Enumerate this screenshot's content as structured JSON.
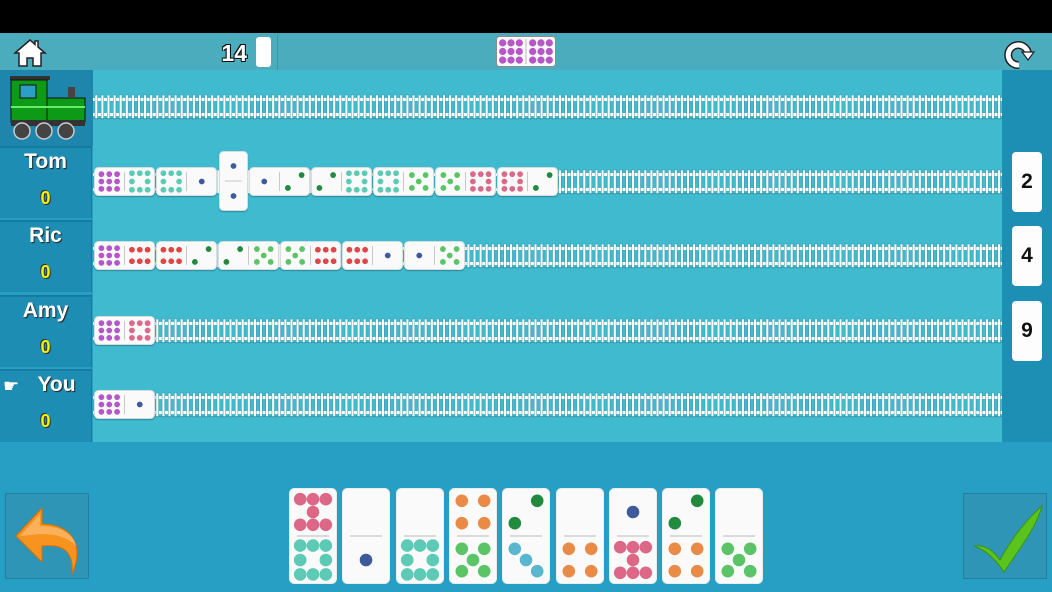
{
  "header": {
    "boneyard_count": "14",
    "engine_domino": [
      9,
      9
    ],
    "home_icon": "home-icon",
    "restart_icon": "restart-icon"
  },
  "pip_colors": {
    "1": "#3f5a99",
    "2": "#218a3e",
    "3": "#59b6cf",
    "4": "#e98a47",
    "5": "#5ac466",
    "6": "#e04646",
    "7": "#dd6787",
    "8": "#da6a8a",
    "9": "#b656ca",
    "10": "#5ccab5"
  },
  "players": [
    {
      "name": "Tom",
      "score": "0",
      "hand_count": "2",
      "is_you": false,
      "train": [
        [
          9,
          10
        ],
        [
          10,
          1
        ],
        [
          1,
          1
        ],
        [
          1,
          2
        ],
        [
          2,
          10
        ],
        [
          10,
          5
        ],
        [
          5,
          8
        ],
        [
          8,
          2
        ]
      ]
    },
    {
      "name": "Ric",
      "score": "0",
      "hand_count": "4",
      "is_you": false,
      "train": [
        [
          9,
          6
        ],
        [
          6,
          2
        ],
        [
          2,
          5
        ],
        [
          5,
          6
        ],
        [
          6,
          1
        ],
        [
          1,
          5
        ]
      ]
    },
    {
      "name": "Amy",
      "score": "0",
      "hand_count": "9",
      "is_you": false,
      "train": [
        [
          9,
          8
        ]
      ]
    },
    {
      "name": "You",
      "score": "0",
      "hand_count": "",
      "is_you": true,
      "train": [
        [
          9,
          1
        ]
      ]
    }
  ],
  "hand": [
    [
      7,
      10
    ],
    [
      0,
      1
    ],
    [
      0,
      10
    ],
    [
      4,
      5
    ],
    [
      2,
      3
    ],
    [
      0,
      4
    ],
    [
      1,
      7
    ],
    [
      2,
      4
    ],
    [
      0,
      5
    ]
  ],
  "buttons": {
    "undo_icon": "undo-arrow-icon",
    "confirm_icon": "checkmark-icon"
  }
}
